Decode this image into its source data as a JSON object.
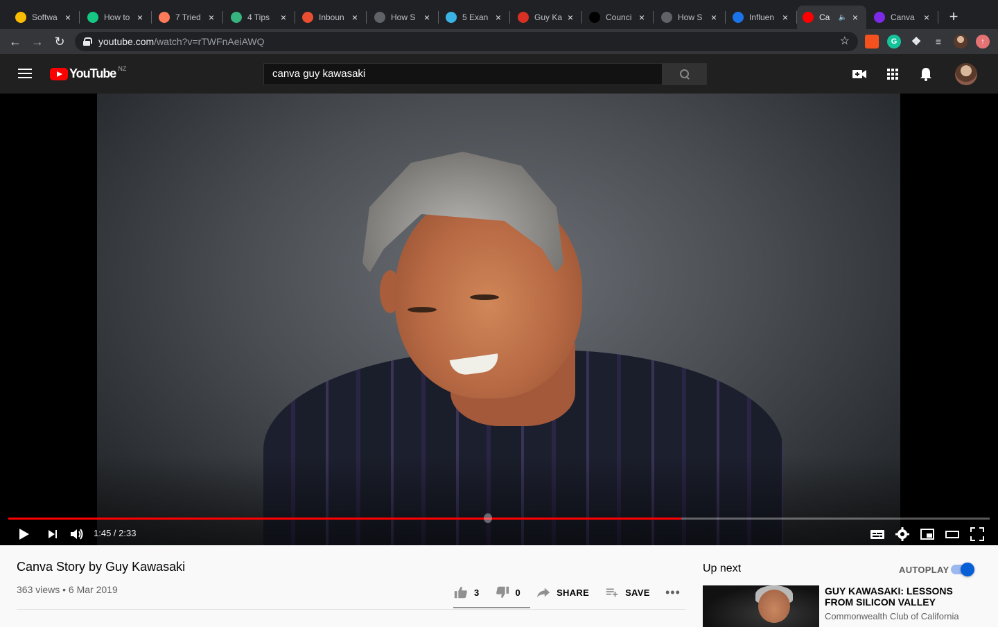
{
  "browser": {
    "tabs": [
      {
        "title": "Softwa",
        "favicon": "google-drive-icon",
        "color": "#fbbc04"
      },
      {
        "title": "How to",
        "favicon": "checkmark-icon",
        "color": "#16c784"
      },
      {
        "title": "7 Tried",
        "favicon": "hubspot-icon",
        "color": "#ff7a59"
      },
      {
        "title": "4 Tips",
        "favicon": "leaf-icon",
        "color": "#36b37e"
      },
      {
        "title": "Inboun",
        "favicon": "hubspot-ring-icon",
        "color": "#e94e32"
      },
      {
        "title": "How S",
        "favicon": "globe-icon",
        "color": "#5f6368"
      },
      {
        "title": "5 Exan",
        "favicon": "spiral-icon",
        "color": "#3ab4e5"
      },
      {
        "title": "Guy Ka",
        "favicon": "gk-icon",
        "color": "#d93025"
      },
      {
        "title": "Counci",
        "favicon": "forbes-icon",
        "color": "#000000"
      },
      {
        "title": "How S",
        "favicon": "globe-icon",
        "color": "#5f6368"
      },
      {
        "title": "Influen",
        "favicon": "star-badge-icon",
        "color": "#1a73e8"
      },
      {
        "title": "Ca",
        "favicon": "youtube-icon",
        "color": "#ff0000",
        "active": true,
        "audio": "speaker-icon"
      },
      {
        "title": "Canva",
        "favicon": "canva-icon",
        "color": "#7d2ae8"
      }
    ],
    "url_host": "youtube.com",
    "url_path": "/watch?v=rTWFnAeiAWQ"
  },
  "youtube": {
    "logo_text": "YouTube",
    "region": "NZ",
    "search_value": "canva guy kawasaki"
  },
  "player": {
    "current_time": "1:45",
    "duration": "2:33",
    "time_display": "1:45 / 2:33",
    "progress_fraction": 0.686
  },
  "video": {
    "title": "Canva Story by Guy Kawasaki",
    "meta": "363 views • 6 Mar 2019",
    "likes": "3",
    "dislikes": "0",
    "share_label": "SHARE",
    "save_label": "SAVE"
  },
  "sidebar": {
    "upnext_label": "Up next",
    "autoplay_label": "AUTOPLAY",
    "autoplay_on": true,
    "rec_title": "GUY KAWASAKI: LESSONS FROM SILICON VALLEY",
    "rec_channel": "Commonwealth Club of California"
  },
  "colors": {
    "accent": "#ff0000",
    "toggle": "#065fd4"
  }
}
